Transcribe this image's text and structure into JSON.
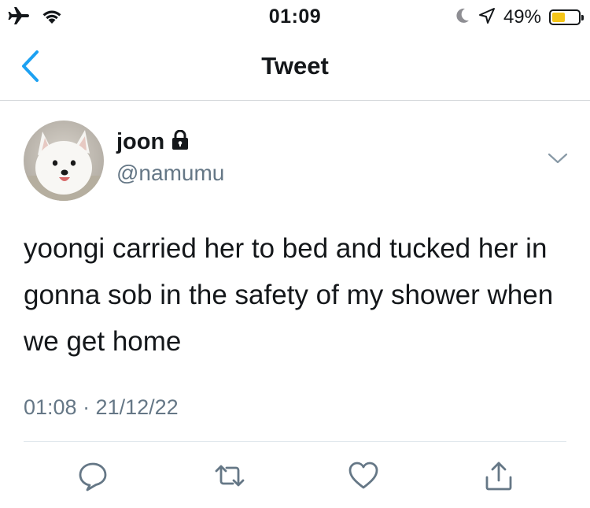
{
  "status_bar": {
    "time": "01:09",
    "battery_percent": "49%",
    "battery_level": 0.49,
    "battery_color": "#f5c518",
    "icons": [
      "airplane-icon",
      "wifi-icon",
      "moon-icon",
      "location-icon",
      "battery-icon"
    ]
  },
  "nav": {
    "title": "Tweet",
    "back_icon": "chevron-left-icon",
    "accent_color": "#1da1f2"
  },
  "tweet": {
    "display_name": "joon",
    "protected_icon": "lock-icon",
    "handle": "@namumu",
    "text": "yoongi carried her to bed and tucked her in gonna sob in the safety of my shower when we get home",
    "timestamp": "01:08 · 21/12/22"
  },
  "actions": [
    {
      "name": "reply",
      "icon": "reply-icon"
    },
    {
      "name": "retweet",
      "icon": "retweet-icon"
    },
    {
      "name": "like",
      "icon": "heart-icon"
    },
    {
      "name": "share",
      "icon": "share-icon"
    }
  ]
}
